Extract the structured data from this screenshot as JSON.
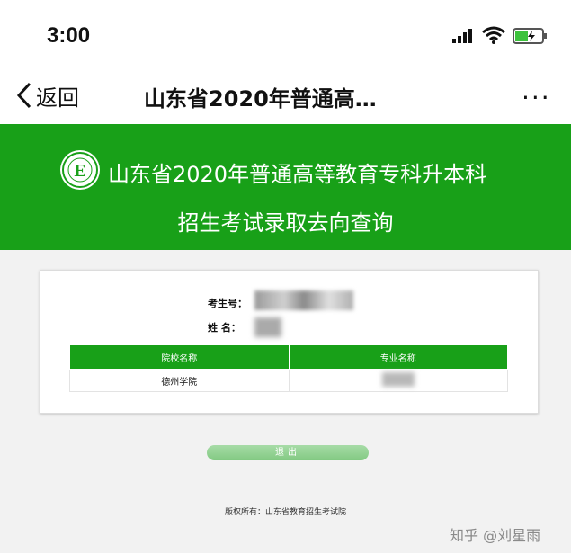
{
  "status_bar": {
    "time": "3:00"
  },
  "nav": {
    "back_label": "返回",
    "title": "山东省2020年普通高…",
    "more": "···"
  },
  "banner": {
    "line1": "山东省2020年普通高等教育专科升本科",
    "line2": "招生考试录取去向查询"
  },
  "result": {
    "exam_number_label": "考生号：",
    "name_label": "姓 名：",
    "table": {
      "headers": [
        "院校名称",
        "专业名称"
      ],
      "rows": [
        [
          "德州学院",
          ""
        ]
      ]
    }
  },
  "exit_button": {
    "label": "退出"
  },
  "footer": {
    "copyright": "版权所有：山东省教育招生考试院"
  },
  "watermark": "知乎 @刘星雨",
  "colors": {
    "brand_green": "#18a018",
    "button_green": "#8fd08f"
  }
}
